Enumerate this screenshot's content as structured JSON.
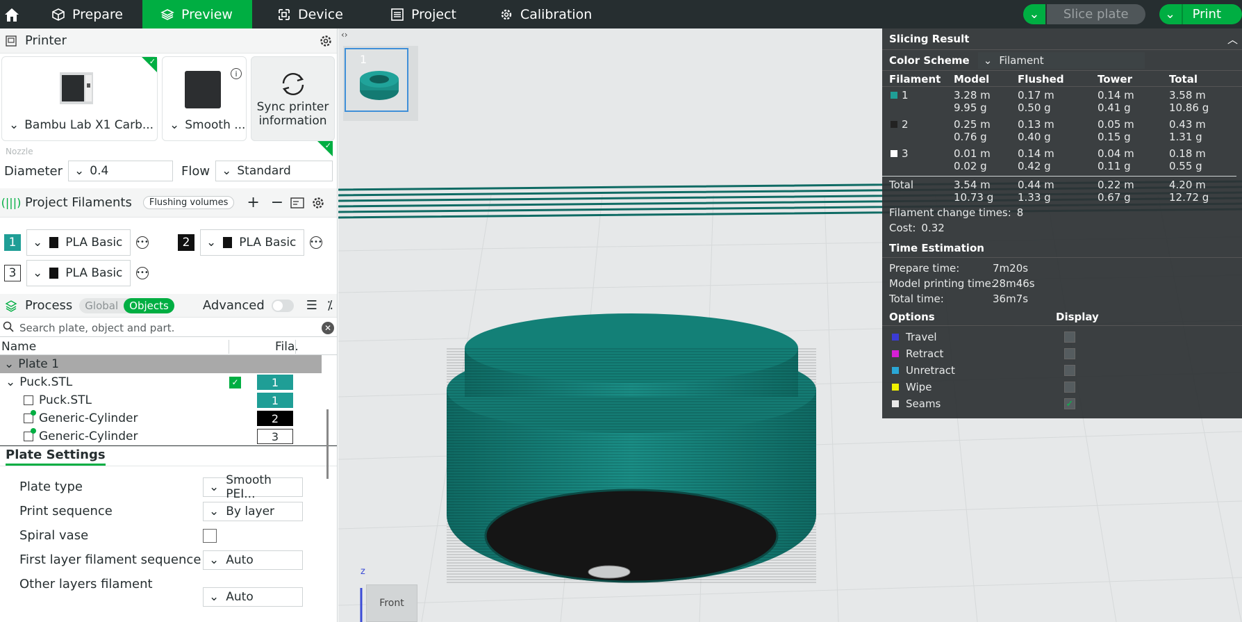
{
  "topbar": {
    "tabs": [
      {
        "label": "Prepare",
        "icon": "cube-icon"
      },
      {
        "label": "Preview",
        "icon": "layers-icon",
        "active": true
      },
      {
        "label": "Device",
        "icon": "device-icon"
      },
      {
        "label": "Project",
        "icon": "list-icon"
      },
      {
        "label": "Calibration",
        "icon": "gear-icon"
      }
    ],
    "slice_label": "Slice plate",
    "print_label": "Print"
  },
  "printer": {
    "title": "Printer",
    "printer_name": "Bambu Lab X1 Carb...",
    "plate_name": "Smooth ...",
    "sync_label_1": "Sync printer",
    "sync_label_2": "information",
    "nozzle_label": "Nozzle",
    "diameter_label": "Diameter",
    "diameter_value": "0.4",
    "flow_label": "Flow",
    "flow_value": "Standard"
  },
  "filaments": {
    "title": "Project Filaments",
    "flushing_label": "Flushing volumes",
    "items": [
      {
        "num": "1",
        "name": "PLA Basic",
        "color": "#1f9e96"
      },
      {
        "num": "2",
        "name": "PLA Basic",
        "color": "#111111"
      },
      {
        "num": "3",
        "name": "PLA Basic",
        "color": "#ffffff"
      }
    ]
  },
  "process": {
    "title": "Process",
    "global_label": "Global",
    "objects_label": "Objects",
    "advanced_label": "Advanced",
    "search_placeholder": "Search plate, object and part."
  },
  "tree": {
    "col_name": "Name",
    "col_fila": "Fila.",
    "plate": "Plate 1",
    "rows": [
      {
        "name": "Puck.STL",
        "fila": "1"
      },
      {
        "name": "Puck.STL",
        "fila": "1"
      },
      {
        "name": "Generic-Cylinder",
        "fila": "2"
      },
      {
        "name": "Generic-Cylinder",
        "fila": "3"
      }
    ]
  },
  "plate_settings": {
    "title": "Plate Settings",
    "plate_type_label": "Plate type",
    "plate_type_value": "Smooth PEI...",
    "print_seq_label": "Print sequence",
    "print_seq_value": "By layer",
    "spiral_label": "Spiral vase",
    "first_layer_label": "First layer filament sequence",
    "first_layer_value": "Auto",
    "other_layers_label": "Other layers filament",
    "other_layers_value": "Auto"
  },
  "viewport": {
    "plate_thumb_num": "1",
    "axis_z": "z",
    "view_cube_label": "Front"
  },
  "slicing": {
    "title": "Slicing Result",
    "color_scheme_label": "Color Scheme",
    "color_scheme_value": "Filament",
    "headers": [
      "Filament",
      "Model",
      "Flushed",
      "Tower",
      "Total"
    ],
    "rows": [
      {
        "id": "1",
        "color": "#1f9e96",
        "model": [
          "3.28 m",
          "9.95 g"
        ],
        "flushed": [
          "0.17 m",
          "0.50 g"
        ],
        "tower": [
          "0.14 m",
          "0.41 g"
        ],
        "total": [
          "3.58 m",
          "10.86 g"
        ]
      },
      {
        "id": "2",
        "color": "#222222",
        "model": [
          "0.25 m",
          "0.76 g"
        ],
        "flushed": [
          "0.13 m",
          "0.40 g"
        ],
        "tower": [
          "0.05 m",
          "0.15 g"
        ],
        "total": [
          "0.43 m",
          "1.31 g"
        ]
      },
      {
        "id": "3",
        "color": "#ffffff",
        "model": [
          "0.01 m",
          "0.02 g"
        ],
        "flushed": [
          "0.14 m",
          "0.42 g"
        ],
        "tower": [
          "0.04 m",
          "0.11 g"
        ],
        "total": [
          "0.18 m",
          "0.55 g"
        ]
      }
    ],
    "total_label": "Total",
    "total": {
      "model": [
        "3.54 m",
        "10.73 g"
      ],
      "flushed": [
        "0.44 m",
        "1.33 g"
      ],
      "tower": [
        "0.22 m",
        "0.67 g"
      ],
      "total": [
        "4.20 m",
        "12.72 g"
      ]
    },
    "change_label": "Filament change times:",
    "change_value": "8",
    "cost_label": "Cost:",
    "cost_value": "0.32",
    "time_title": "Time Estimation",
    "prepare_label": "Prepare time:",
    "prepare_value": "7m20s",
    "model_time_label": "Model printing time:",
    "model_time_value": "28m46s",
    "total_time_label": "Total time:",
    "total_time_value": "36m7s",
    "options_label": "Options",
    "display_label": "Display",
    "options": [
      {
        "name": "Travel",
        "color": "#3b3bd6",
        "checked": false
      },
      {
        "name": "Retract",
        "color": "#d61fd6",
        "checked": false
      },
      {
        "name": "Unretract",
        "color": "#2aa7d6",
        "checked": false
      },
      {
        "name": "Wipe",
        "color": "#f0f000",
        "checked": false
      },
      {
        "name": "Seams",
        "color": "#e8e8e8",
        "checked": true
      }
    ]
  }
}
